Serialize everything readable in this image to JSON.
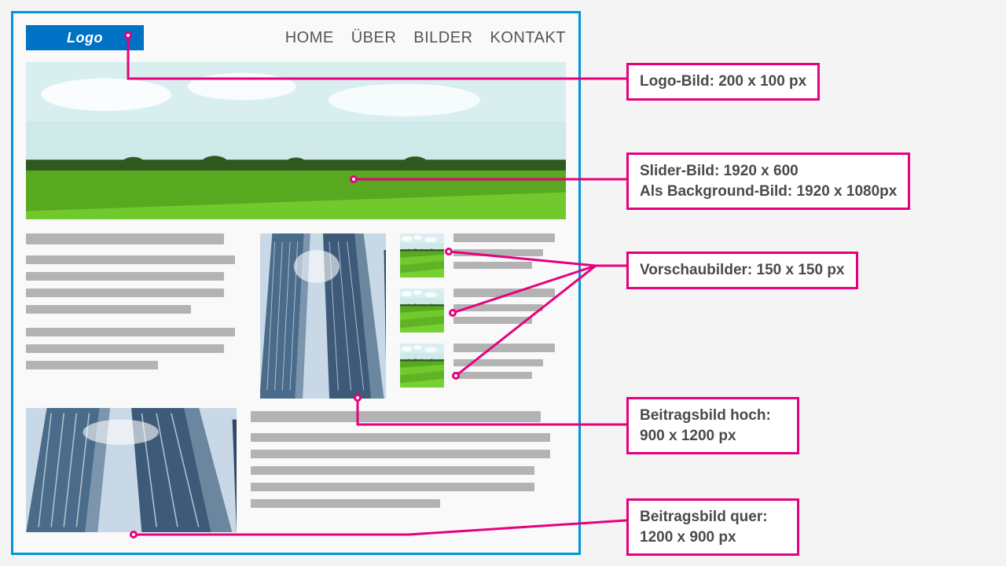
{
  "logo_text": "Logo",
  "nav": {
    "items": [
      "HOME",
      "ÜBER",
      "BILDER",
      "KONTAKT"
    ]
  },
  "callouts": {
    "logo": "Logo-Bild: 200 x 100 px",
    "slider_line1": "Slider-Bild: 1920 x 600",
    "slider_line2": "Als Background-Bild: 1920 x 1080px",
    "thumbs": "Vorschaubilder: 150 x 150 px",
    "portrait_line1": "Beitragsbild hoch:",
    "portrait_line2": "900 x 1200 px",
    "landscape_line1": "Beitragsbild quer:",
    "landscape_line2": "1200 x 900 px"
  }
}
